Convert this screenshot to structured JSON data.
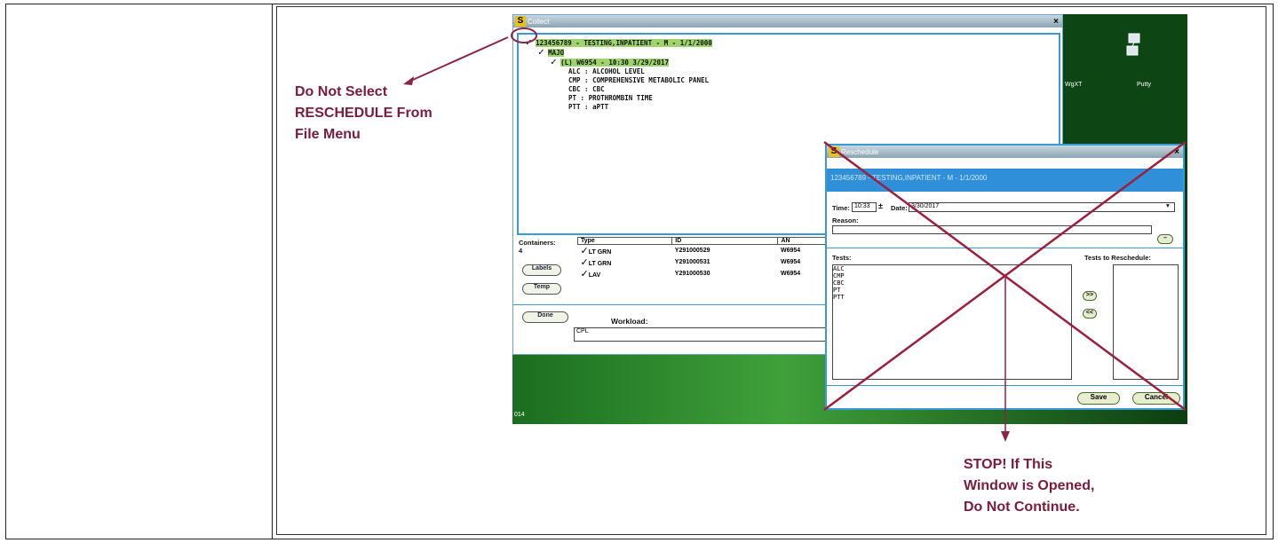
{
  "annotations": {
    "top_lines": [
      "Do Not Select",
      "RESCHEDULE From",
      "File Menu"
    ],
    "bottom_lines": [
      "STOP!  If This",
      "Window is Opened,",
      "Do Not Continue."
    ],
    "color": "#7a1c3a"
  },
  "collect_window": {
    "title": "Collect",
    "tree": {
      "patient": "123456789 - TESTING,INPATIENT - M - 1/1/2000",
      "location": "MAJO",
      "order": "(L) W6954 - 10:30 3/29/2017",
      "tests": [
        "ALC : ALCOHOL LEVEL",
        "CMP : COMPREHENSIVE METABOLIC PANEL",
        "CBC : CBC",
        "PT : PROTHROMBIN TIME",
        "PTT : aPTT"
      ]
    },
    "containers_label": "Containers:",
    "containers_count": "4",
    "labels_button": "Labels",
    "temp_button": "Temp",
    "done_button": "Done",
    "table_headers": [
      "Type",
      "ID",
      "AN"
    ],
    "table_rows": [
      [
        "LT GRN",
        "Y291000529",
        "W6954"
      ],
      [
        "LT GRN",
        "Y291000531",
        "W6954"
      ],
      [
        "LAV",
        "Y291000530",
        "W6954"
      ]
    ],
    "workload_label": "Workload:",
    "workload_value": "CPL"
  },
  "desktop": {
    "icon_label_1": "WgXT",
    "icon_label_2": "Putty",
    "taskbar_text": "014"
  },
  "reschedule_window": {
    "title": "Reschedule",
    "patient_banner": "123456789 - TESTING,INPATIENT - M - 1/1/2000",
    "time_label": "Time:",
    "time_value": "10:33",
    "date_label": "Date:",
    "date_value": "3/30/2017",
    "reason_label": "Reason:",
    "tests_label": "Tests:",
    "tests_to_reschedule_label": "Tests to Reschedule:",
    "tests": [
      "ALC",
      "CMP",
      "CBC",
      "PT",
      "PTT"
    ],
    "move_right_button": ">>",
    "move_left_button": "<<",
    "save_button": "Save",
    "cancel_button": "Cancel"
  }
}
